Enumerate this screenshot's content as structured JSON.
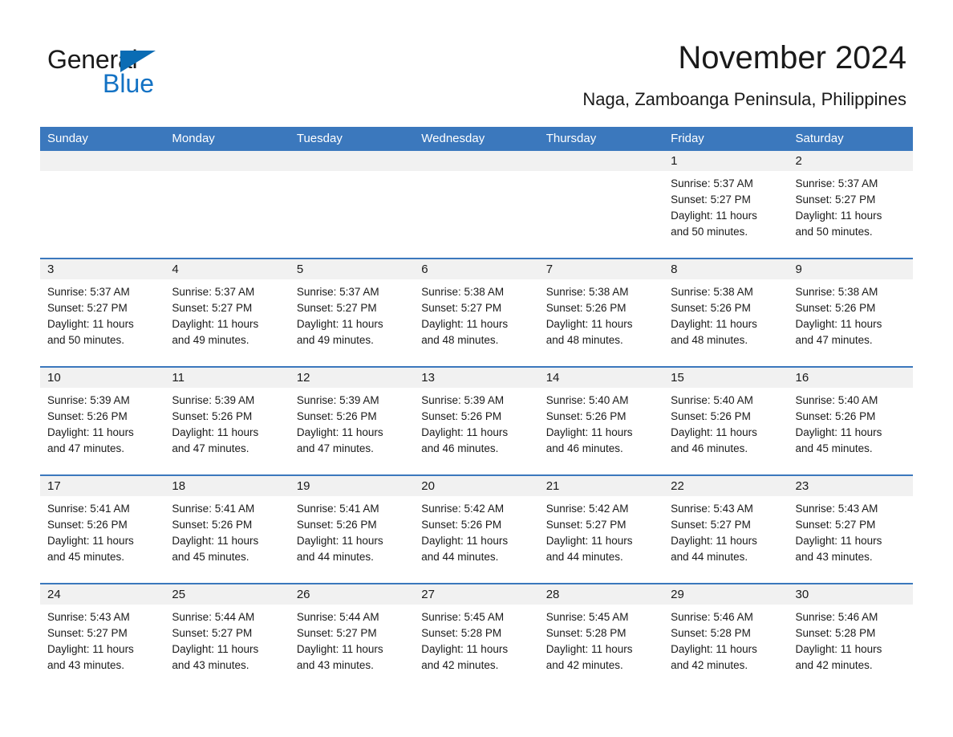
{
  "brand": {
    "name_part1": "General",
    "name_part2": "Blue",
    "flag_icon": "triangle-flag-icon",
    "accent_color": "#1372c4"
  },
  "header": {
    "month_title": "November 2024",
    "location": "Naga, Zamboanga Peninsula, Philippines"
  },
  "theme": {
    "header_blue": "#3b78bd",
    "date_band_gray": "#f1f1f1",
    "text_color": "#1a1a1a"
  },
  "calendar": {
    "weekday_headers": [
      "Sunday",
      "Monday",
      "Tuesday",
      "Wednesday",
      "Thursday",
      "Friday",
      "Saturday"
    ],
    "weeks": [
      [
        {
          "date": "",
          "lines": []
        },
        {
          "date": "",
          "lines": []
        },
        {
          "date": "",
          "lines": []
        },
        {
          "date": "",
          "lines": []
        },
        {
          "date": "",
          "lines": []
        },
        {
          "date": "1",
          "lines": [
            "Sunrise: 5:37 AM",
            "Sunset: 5:27 PM",
            "Daylight: 11 hours",
            "and 50 minutes."
          ]
        },
        {
          "date": "2",
          "lines": [
            "Sunrise: 5:37 AM",
            "Sunset: 5:27 PM",
            "Daylight: 11 hours",
            "and 50 minutes."
          ]
        }
      ],
      [
        {
          "date": "3",
          "lines": [
            "Sunrise: 5:37 AM",
            "Sunset: 5:27 PM",
            "Daylight: 11 hours",
            "and 50 minutes."
          ]
        },
        {
          "date": "4",
          "lines": [
            "Sunrise: 5:37 AM",
            "Sunset: 5:27 PM",
            "Daylight: 11 hours",
            "and 49 minutes."
          ]
        },
        {
          "date": "5",
          "lines": [
            "Sunrise: 5:37 AM",
            "Sunset: 5:27 PM",
            "Daylight: 11 hours",
            "and 49 minutes."
          ]
        },
        {
          "date": "6",
          "lines": [
            "Sunrise: 5:38 AM",
            "Sunset: 5:27 PM",
            "Daylight: 11 hours",
            "and 48 minutes."
          ]
        },
        {
          "date": "7",
          "lines": [
            "Sunrise: 5:38 AM",
            "Sunset: 5:26 PM",
            "Daylight: 11 hours",
            "and 48 minutes."
          ]
        },
        {
          "date": "8",
          "lines": [
            "Sunrise: 5:38 AM",
            "Sunset: 5:26 PM",
            "Daylight: 11 hours",
            "and 48 minutes."
          ]
        },
        {
          "date": "9",
          "lines": [
            "Sunrise: 5:38 AM",
            "Sunset: 5:26 PM",
            "Daylight: 11 hours",
            "and 47 minutes."
          ]
        }
      ],
      [
        {
          "date": "10",
          "lines": [
            "Sunrise: 5:39 AM",
            "Sunset: 5:26 PM",
            "Daylight: 11 hours",
            "and 47 minutes."
          ]
        },
        {
          "date": "11",
          "lines": [
            "Sunrise: 5:39 AM",
            "Sunset: 5:26 PM",
            "Daylight: 11 hours",
            "and 47 minutes."
          ]
        },
        {
          "date": "12",
          "lines": [
            "Sunrise: 5:39 AM",
            "Sunset: 5:26 PM",
            "Daylight: 11 hours",
            "and 47 minutes."
          ]
        },
        {
          "date": "13",
          "lines": [
            "Sunrise: 5:39 AM",
            "Sunset: 5:26 PM",
            "Daylight: 11 hours",
            "and 46 minutes."
          ]
        },
        {
          "date": "14",
          "lines": [
            "Sunrise: 5:40 AM",
            "Sunset: 5:26 PM",
            "Daylight: 11 hours",
            "and 46 minutes."
          ]
        },
        {
          "date": "15",
          "lines": [
            "Sunrise: 5:40 AM",
            "Sunset: 5:26 PM",
            "Daylight: 11 hours",
            "and 46 minutes."
          ]
        },
        {
          "date": "16",
          "lines": [
            "Sunrise: 5:40 AM",
            "Sunset: 5:26 PM",
            "Daylight: 11 hours",
            "and 45 minutes."
          ]
        }
      ],
      [
        {
          "date": "17",
          "lines": [
            "Sunrise: 5:41 AM",
            "Sunset: 5:26 PM",
            "Daylight: 11 hours",
            "and 45 minutes."
          ]
        },
        {
          "date": "18",
          "lines": [
            "Sunrise: 5:41 AM",
            "Sunset: 5:26 PM",
            "Daylight: 11 hours",
            "and 45 minutes."
          ]
        },
        {
          "date": "19",
          "lines": [
            "Sunrise: 5:41 AM",
            "Sunset: 5:26 PM",
            "Daylight: 11 hours",
            "and 44 minutes."
          ]
        },
        {
          "date": "20",
          "lines": [
            "Sunrise: 5:42 AM",
            "Sunset: 5:26 PM",
            "Daylight: 11 hours",
            "and 44 minutes."
          ]
        },
        {
          "date": "21",
          "lines": [
            "Sunrise: 5:42 AM",
            "Sunset: 5:27 PM",
            "Daylight: 11 hours",
            "and 44 minutes."
          ]
        },
        {
          "date": "22",
          "lines": [
            "Sunrise: 5:43 AM",
            "Sunset: 5:27 PM",
            "Daylight: 11 hours",
            "and 44 minutes."
          ]
        },
        {
          "date": "23",
          "lines": [
            "Sunrise: 5:43 AM",
            "Sunset: 5:27 PM",
            "Daylight: 11 hours",
            "and 43 minutes."
          ]
        }
      ],
      [
        {
          "date": "24",
          "lines": [
            "Sunrise: 5:43 AM",
            "Sunset: 5:27 PM",
            "Daylight: 11 hours",
            "and 43 minutes."
          ]
        },
        {
          "date": "25",
          "lines": [
            "Sunrise: 5:44 AM",
            "Sunset: 5:27 PM",
            "Daylight: 11 hours",
            "and 43 minutes."
          ]
        },
        {
          "date": "26",
          "lines": [
            "Sunrise: 5:44 AM",
            "Sunset: 5:27 PM",
            "Daylight: 11 hours",
            "and 43 minutes."
          ]
        },
        {
          "date": "27",
          "lines": [
            "Sunrise: 5:45 AM",
            "Sunset: 5:28 PM",
            "Daylight: 11 hours",
            "and 42 minutes."
          ]
        },
        {
          "date": "28",
          "lines": [
            "Sunrise: 5:45 AM",
            "Sunset: 5:28 PM",
            "Daylight: 11 hours",
            "and 42 minutes."
          ]
        },
        {
          "date": "29",
          "lines": [
            "Sunrise: 5:46 AM",
            "Sunset: 5:28 PM",
            "Daylight: 11 hours",
            "and 42 minutes."
          ]
        },
        {
          "date": "30",
          "lines": [
            "Sunrise: 5:46 AM",
            "Sunset: 5:28 PM",
            "Daylight: 11 hours",
            "and 42 minutes."
          ]
        }
      ]
    ]
  }
}
